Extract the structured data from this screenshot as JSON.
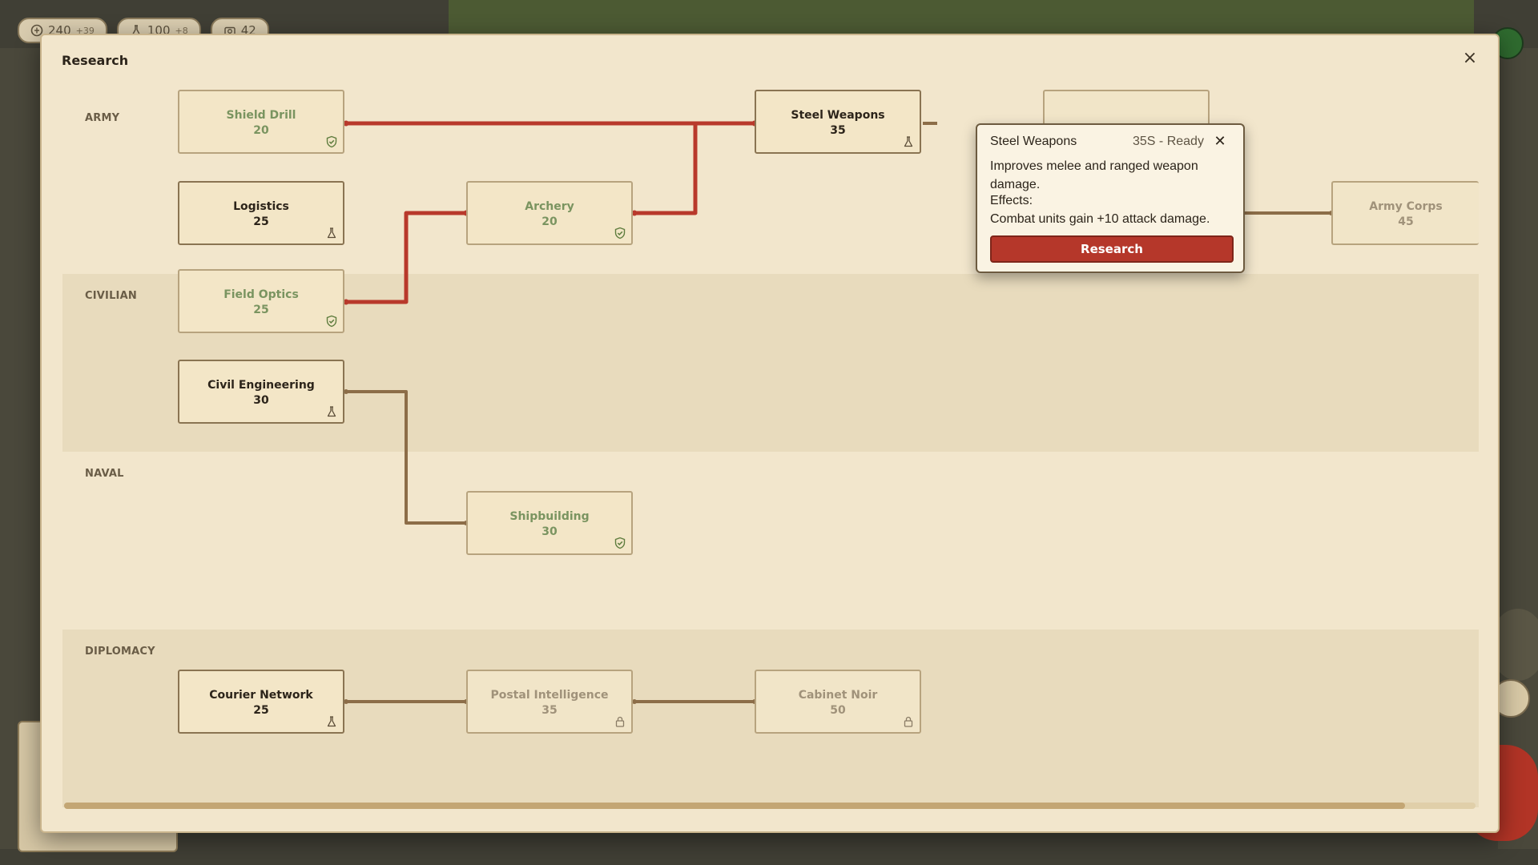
{
  "hud": {
    "gold": {
      "value": "240",
      "delta": "+39",
      "icon": "coin-icon"
    },
    "science": {
      "value": "100",
      "delta": "+8",
      "icon": "flask-icon"
    },
    "units": {
      "value": "42",
      "icon": "camera-icon"
    }
  },
  "modal": {
    "title": "Research",
    "close_label": "×"
  },
  "lanes": [
    "ARMY",
    "CIVILIAN",
    "NAVAL",
    "DIPLOMACY"
  ],
  "nodes": {
    "shield_drill": {
      "name": "Shield Drill",
      "cost": "20",
      "state": "researched"
    },
    "logistics": {
      "name": "Logistics",
      "cost": "25",
      "state": "available"
    },
    "archery": {
      "name": "Archery",
      "cost": "20",
      "state": "researched"
    },
    "steel_weapons": {
      "name": "Steel Weapons",
      "cost": "35",
      "state": "available"
    },
    "army_corps": {
      "name": "Army Corps",
      "cost": "45",
      "state": "locked"
    },
    "field_optics": {
      "name": "Field Optics",
      "cost": "25",
      "state": "researched"
    },
    "civil_engineering": {
      "name": "Civil Engineering",
      "cost": "30",
      "state": "available"
    },
    "shipbuilding": {
      "name": "Shipbuilding",
      "cost": "30",
      "state": "researched"
    },
    "courier_network": {
      "name": "Courier Network",
      "cost": "25",
      "state": "available"
    },
    "postal_intelligence": {
      "name": "Postal Intelligence",
      "cost": "35",
      "state": "locked"
    },
    "cabinet_noir": {
      "name": "Cabinet Noir",
      "cost": "50",
      "state": "locked"
    }
  },
  "tooltip": {
    "title": "Steel Weapons",
    "status": "35S - Ready",
    "close_label": "✕",
    "description": "Improves melee and ranged weapon damage.",
    "effects_label": "Effects:",
    "effect": "Combat units gain +10 attack damage.",
    "button_label": "Research"
  },
  "scrollbar": {
    "position_fraction": 0.95
  },
  "colors": {
    "accent_red": "#b5372a",
    "path_active": "#b8392b",
    "path_inactive": "#8c6d48",
    "researched_text": "#7a9460",
    "locked_text": "#a0927a"
  }
}
